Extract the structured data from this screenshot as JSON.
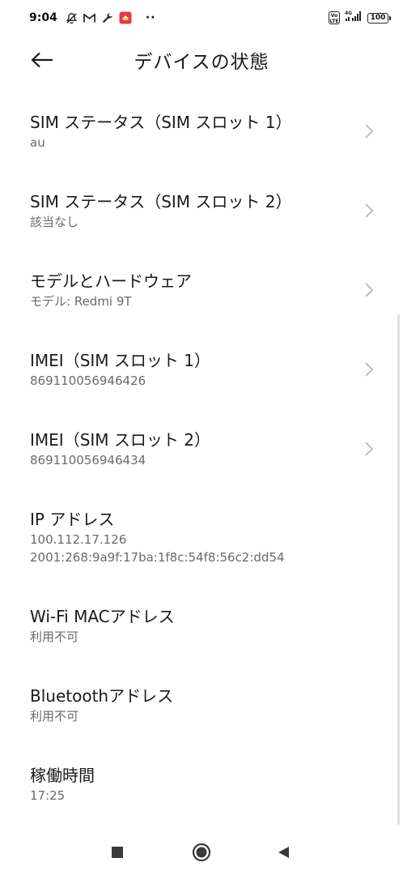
{
  "status_bar": {
    "time": "9:04",
    "icons": [
      "mute-icon",
      "gmail-icon",
      "wrench-icon",
      "app-notification-icon"
    ],
    "dots": "··",
    "volte_label": "Vo LTE",
    "network_label": "4G",
    "battery_level": "100"
  },
  "header": {
    "title": "デバイスの状態",
    "back_icon": "back-arrow-icon"
  },
  "rows": [
    {
      "title": "SIM ステータス（SIM スロット 1）",
      "subtitle": "au",
      "has_chevron": true
    },
    {
      "title": "SIM ステータス（SIM スロット 2）",
      "subtitle": "該当なし",
      "has_chevron": true
    },
    {
      "title": "モデルとハードウェア",
      "subtitle": "モデル: Redmi 9T",
      "has_chevron": true
    },
    {
      "title": "IMEI（SIM スロット 1）",
      "subtitle": "869110056946426",
      "has_chevron": true
    },
    {
      "title": "IMEI（SIM スロット 2）",
      "subtitle": "869110056946434",
      "has_chevron": true
    },
    {
      "title": "IP アドレス",
      "subtitle": "100.112.17.126",
      "subtitle2": "2001:268:9a9f:17ba:1f8c:54f8:56c2:dd54",
      "has_chevron": false
    },
    {
      "title": "Wi-Fi MACアドレス",
      "subtitle": "利用不可",
      "has_chevron": false
    },
    {
      "title": "Bluetoothアドレス",
      "subtitle": "利用不可",
      "has_chevron": false
    },
    {
      "title": "稼働時間",
      "subtitle": "17:25",
      "has_chevron": false
    }
  ],
  "nav_bar": {
    "icons": [
      "recents-square-icon",
      "home-circle-icon",
      "back-triangle-icon"
    ]
  },
  "colors": {
    "background": "#ffffff",
    "title_text": "#1a1a1a",
    "subtitle_text": "#6a6a6a",
    "chevron": "#b8b8b8"
  }
}
